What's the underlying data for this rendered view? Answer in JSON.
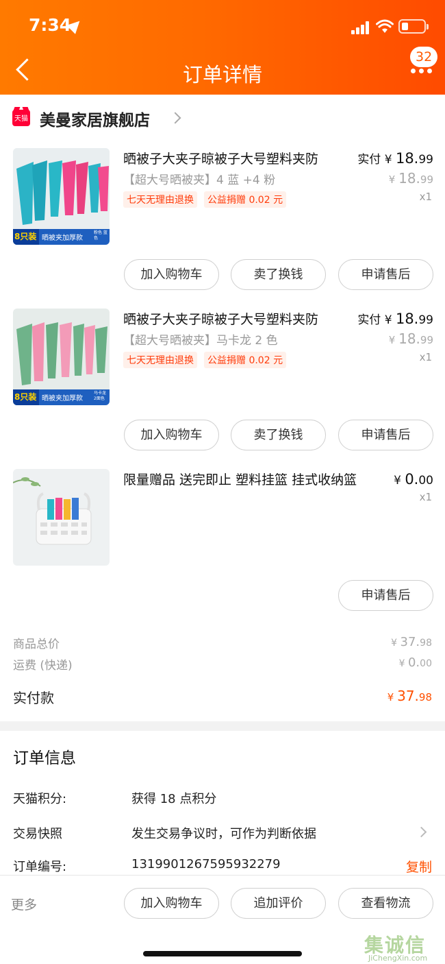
{
  "status_bar": {
    "time": "7:34"
  },
  "header": {
    "title": "订单详情",
    "badge_count": "32"
  },
  "store": {
    "logo_text": "天猫",
    "name": "美曼家居旗舰店"
  },
  "products": [
    {
      "title": "晒被子大夹子晾被子大号塑料夹防",
      "sku": "【超大号晒被夹】4 蓝 +4 粉",
      "tags": [
        "七天无理由退换",
        "公益捐赠 0.02 元"
      ],
      "paid_label": "实付",
      "paid_currency": "¥",
      "paid_int": "18.",
      "paid_dec": "99",
      "orig_currency": "¥",
      "orig_int": "18.",
      "orig_dec": "99",
      "qty": "x1",
      "image_badge": "8只装",
      "image_caption": "晒被夹加厚款",
      "image_note": "粉色 蓝色",
      "buttons": [
        "加入购物车",
        "卖了换钱",
        "申请售后"
      ]
    },
    {
      "title": "晒被子大夹子晾被子大号塑料夹防",
      "sku": "【超大号晒被夹】马卡龙 2 色",
      "tags": [
        "七天无理由退换",
        "公益捐赠 0.02 元"
      ],
      "paid_label": "实付",
      "paid_currency": "¥",
      "paid_int": "18.",
      "paid_dec": "99",
      "orig_currency": "¥",
      "orig_int": "18.",
      "orig_dec": "99",
      "qty": "x1",
      "image_badge": "8只装",
      "image_caption": "晒被夹加厚款",
      "image_note": "马卡龙 2面色",
      "buttons": [
        "加入购物车",
        "卖了换钱",
        "申请售后"
      ]
    },
    {
      "title": "限量赠品 送完即止 塑料挂篮 挂式收纳篮",
      "paid_currency": "¥",
      "paid_int": "0.",
      "paid_dec": "00",
      "qty": "x1",
      "buttons": [
        "申请售后"
      ]
    }
  ],
  "summary": {
    "goods_total_label": "商品总价",
    "goods_total_currency": "¥",
    "goods_total_int": "37.",
    "goods_total_dec": "98",
    "shipping_label": "运费 (快递)",
    "shipping_currency": "¥",
    "shipping_int": "0.",
    "shipping_dec": "00",
    "paid_label": "实付款",
    "paid_currency": "¥",
    "paid_int": "37.",
    "paid_dec": "98"
  },
  "order_info": {
    "title": "订单信息",
    "rows": [
      {
        "label": "天猫积分:",
        "value": "获得 18 点积分"
      },
      {
        "label": "交易快照",
        "value": "发生交易争议时，可作为判断依据"
      },
      {
        "label": "订单编号:",
        "value": "1319901267595932279",
        "action": "复制"
      }
    ]
  },
  "bottom_bar": {
    "more": "更多",
    "buttons": [
      "加入购物车",
      "追加评价",
      "查看物流"
    ]
  },
  "watermark": {
    "text": "集诚信",
    "sub": "JiChengXin.com"
  },
  "colors": {
    "accent": "#ff5000",
    "header_start": "#ff7a00",
    "header_end": "#ff4b00",
    "tag_bg": "#fff0ea"
  }
}
